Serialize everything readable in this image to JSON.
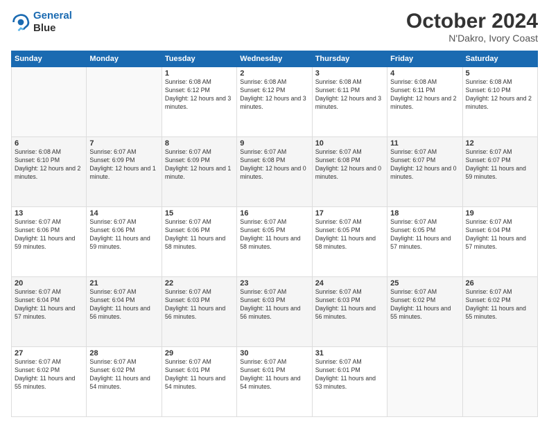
{
  "header": {
    "logo_line1": "General",
    "logo_line2": "Blue",
    "title": "October 2024",
    "subtitle": "N'Dakro, Ivory Coast"
  },
  "days_of_week": [
    "Sunday",
    "Monday",
    "Tuesday",
    "Wednesday",
    "Thursday",
    "Friday",
    "Saturday"
  ],
  "weeks": [
    [
      {
        "day": "",
        "info": ""
      },
      {
        "day": "",
        "info": ""
      },
      {
        "day": "1",
        "info": "Sunrise: 6:08 AM\nSunset: 6:12 PM\nDaylight: 12 hours and 3 minutes."
      },
      {
        "day": "2",
        "info": "Sunrise: 6:08 AM\nSunset: 6:12 PM\nDaylight: 12 hours and 3 minutes."
      },
      {
        "day": "3",
        "info": "Sunrise: 6:08 AM\nSunset: 6:11 PM\nDaylight: 12 hours and 3 minutes."
      },
      {
        "day": "4",
        "info": "Sunrise: 6:08 AM\nSunset: 6:11 PM\nDaylight: 12 hours and 2 minutes."
      },
      {
        "day": "5",
        "info": "Sunrise: 6:08 AM\nSunset: 6:10 PM\nDaylight: 12 hours and 2 minutes."
      }
    ],
    [
      {
        "day": "6",
        "info": "Sunrise: 6:08 AM\nSunset: 6:10 PM\nDaylight: 12 hours and 2 minutes."
      },
      {
        "day": "7",
        "info": "Sunrise: 6:07 AM\nSunset: 6:09 PM\nDaylight: 12 hours and 1 minute."
      },
      {
        "day": "8",
        "info": "Sunrise: 6:07 AM\nSunset: 6:09 PM\nDaylight: 12 hours and 1 minute."
      },
      {
        "day": "9",
        "info": "Sunrise: 6:07 AM\nSunset: 6:08 PM\nDaylight: 12 hours and 0 minutes."
      },
      {
        "day": "10",
        "info": "Sunrise: 6:07 AM\nSunset: 6:08 PM\nDaylight: 12 hours and 0 minutes."
      },
      {
        "day": "11",
        "info": "Sunrise: 6:07 AM\nSunset: 6:07 PM\nDaylight: 12 hours and 0 minutes."
      },
      {
        "day": "12",
        "info": "Sunrise: 6:07 AM\nSunset: 6:07 PM\nDaylight: 11 hours and 59 minutes."
      }
    ],
    [
      {
        "day": "13",
        "info": "Sunrise: 6:07 AM\nSunset: 6:06 PM\nDaylight: 11 hours and 59 minutes."
      },
      {
        "day": "14",
        "info": "Sunrise: 6:07 AM\nSunset: 6:06 PM\nDaylight: 11 hours and 59 minutes."
      },
      {
        "day": "15",
        "info": "Sunrise: 6:07 AM\nSunset: 6:06 PM\nDaylight: 11 hours and 58 minutes."
      },
      {
        "day": "16",
        "info": "Sunrise: 6:07 AM\nSunset: 6:05 PM\nDaylight: 11 hours and 58 minutes."
      },
      {
        "day": "17",
        "info": "Sunrise: 6:07 AM\nSunset: 6:05 PM\nDaylight: 11 hours and 58 minutes."
      },
      {
        "day": "18",
        "info": "Sunrise: 6:07 AM\nSunset: 6:05 PM\nDaylight: 11 hours and 57 minutes."
      },
      {
        "day": "19",
        "info": "Sunrise: 6:07 AM\nSunset: 6:04 PM\nDaylight: 11 hours and 57 minutes."
      }
    ],
    [
      {
        "day": "20",
        "info": "Sunrise: 6:07 AM\nSunset: 6:04 PM\nDaylight: 11 hours and 57 minutes."
      },
      {
        "day": "21",
        "info": "Sunrise: 6:07 AM\nSunset: 6:04 PM\nDaylight: 11 hours and 56 minutes."
      },
      {
        "day": "22",
        "info": "Sunrise: 6:07 AM\nSunset: 6:03 PM\nDaylight: 11 hours and 56 minutes."
      },
      {
        "day": "23",
        "info": "Sunrise: 6:07 AM\nSunset: 6:03 PM\nDaylight: 11 hours and 56 minutes."
      },
      {
        "day": "24",
        "info": "Sunrise: 6:07 AM\nSunset: 6:03 PM\nDaylight: 11 hours and 56 minutes."
      },
      {
        "day": "25",
        "info": "Sunrise: 6:07 AM\nSunset: 6:02 PM\nDaylight: 11 hours and 55 minutes."
      },
      {
        "day": "26",
        "info": "Sunrise: 6:07 AM\nSunset: 6:02 PM\nDaylight: 11 hours and 55 minutes."
      }
    ],
    [
      {
        "day": "27",
        "info": "Sunrise: 6:07 AM\nSunset: 6:02 PM\nDaylight: 11 hours and 55 minutes."
      },
      {
        "day": "28",
        "info": "Sunrise: 6:07 AM\nSunset: 6:02 PM\nDaylight: 11 hours and 54 minutes."
      },
      {
        "day": "29",
        "info": "Sunrise: 6:07 AM\nSunset: 6:01 PM\nDaylight: 11 hours and 54 minutes."
      },
      {
        "day": "30",
        "info": "Sunrise: 6:07 AM\nSunset: 6:01 PM\nDaylight: 11 hours and 54 minutes."
      },
      {
        "day": "31",
        "info": "Sunrise: 6:07 AM\nSunset: 6:01 PM\nDaylight: 11 hours and 53 minutes."
      },
      {
        "day": "",
        "info": ""
      },
      {
        "day": "",
        "info": ""
      }
    ]
  ]
}
